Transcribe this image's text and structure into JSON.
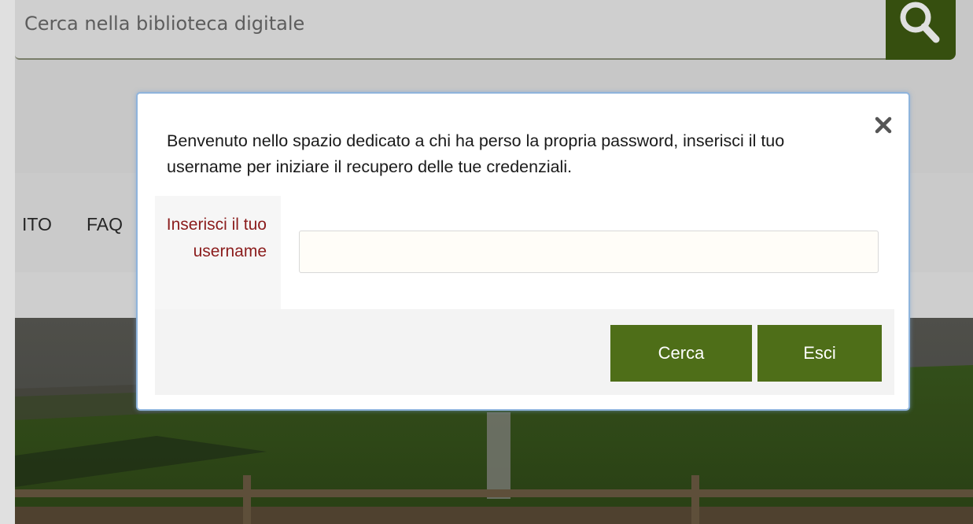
{
  "search": {
    "placeholder": "Cerca nella biblioteca digitale",
    "button_icon": "search-icon"
  },
  "nav": {
    "items": [
      "ITO",
      "FAQ"
    ]
  },
  "modal": {
    "message": "Benvenuto nello spazio dedicato a chi ha perso la propria password, inserisci il tuo username per iniziare il recupero delle tue credenziali.",
    "field_label": "Inserisci il tuo username",
    "input_value": "",
    "close_icon": "close-icon",
    "buttons": {
      "search": "Cerca",
      "exit": "Esci"
    }
  },
  "colors": {
    "accent_green": "#4e6e18",
    "search_button": "#3e5a12",
    "label_red": "#8b1c1c",
    "modal_border": "#8fb4dc"
  }
}
